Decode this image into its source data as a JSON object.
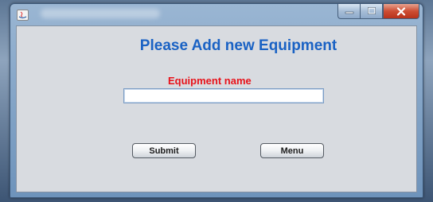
{
  "window": {
    "icons": {
      "app": "java-app-icon",
      "minimize": "minimize-icon",
      "maximize": "maximize-icon",
      "close": "close-icon"
    },
    "colors": {
      "close_button": "#cd4d33",
      "title_bar": "#9ab6d3"
    }
  },
  "form": {
    "heading": "Please Add new Equipment",
    "equipment_label": "Equipment name",
    "equipment_value": "",
    "submit_label": "Submit",
    "menu_label": "Menu",
    "colors": {
      "heading": "#1a62c4",
      "label": "#e8121a",
      "panel": "#d8dbe0"
    }
  }
}
